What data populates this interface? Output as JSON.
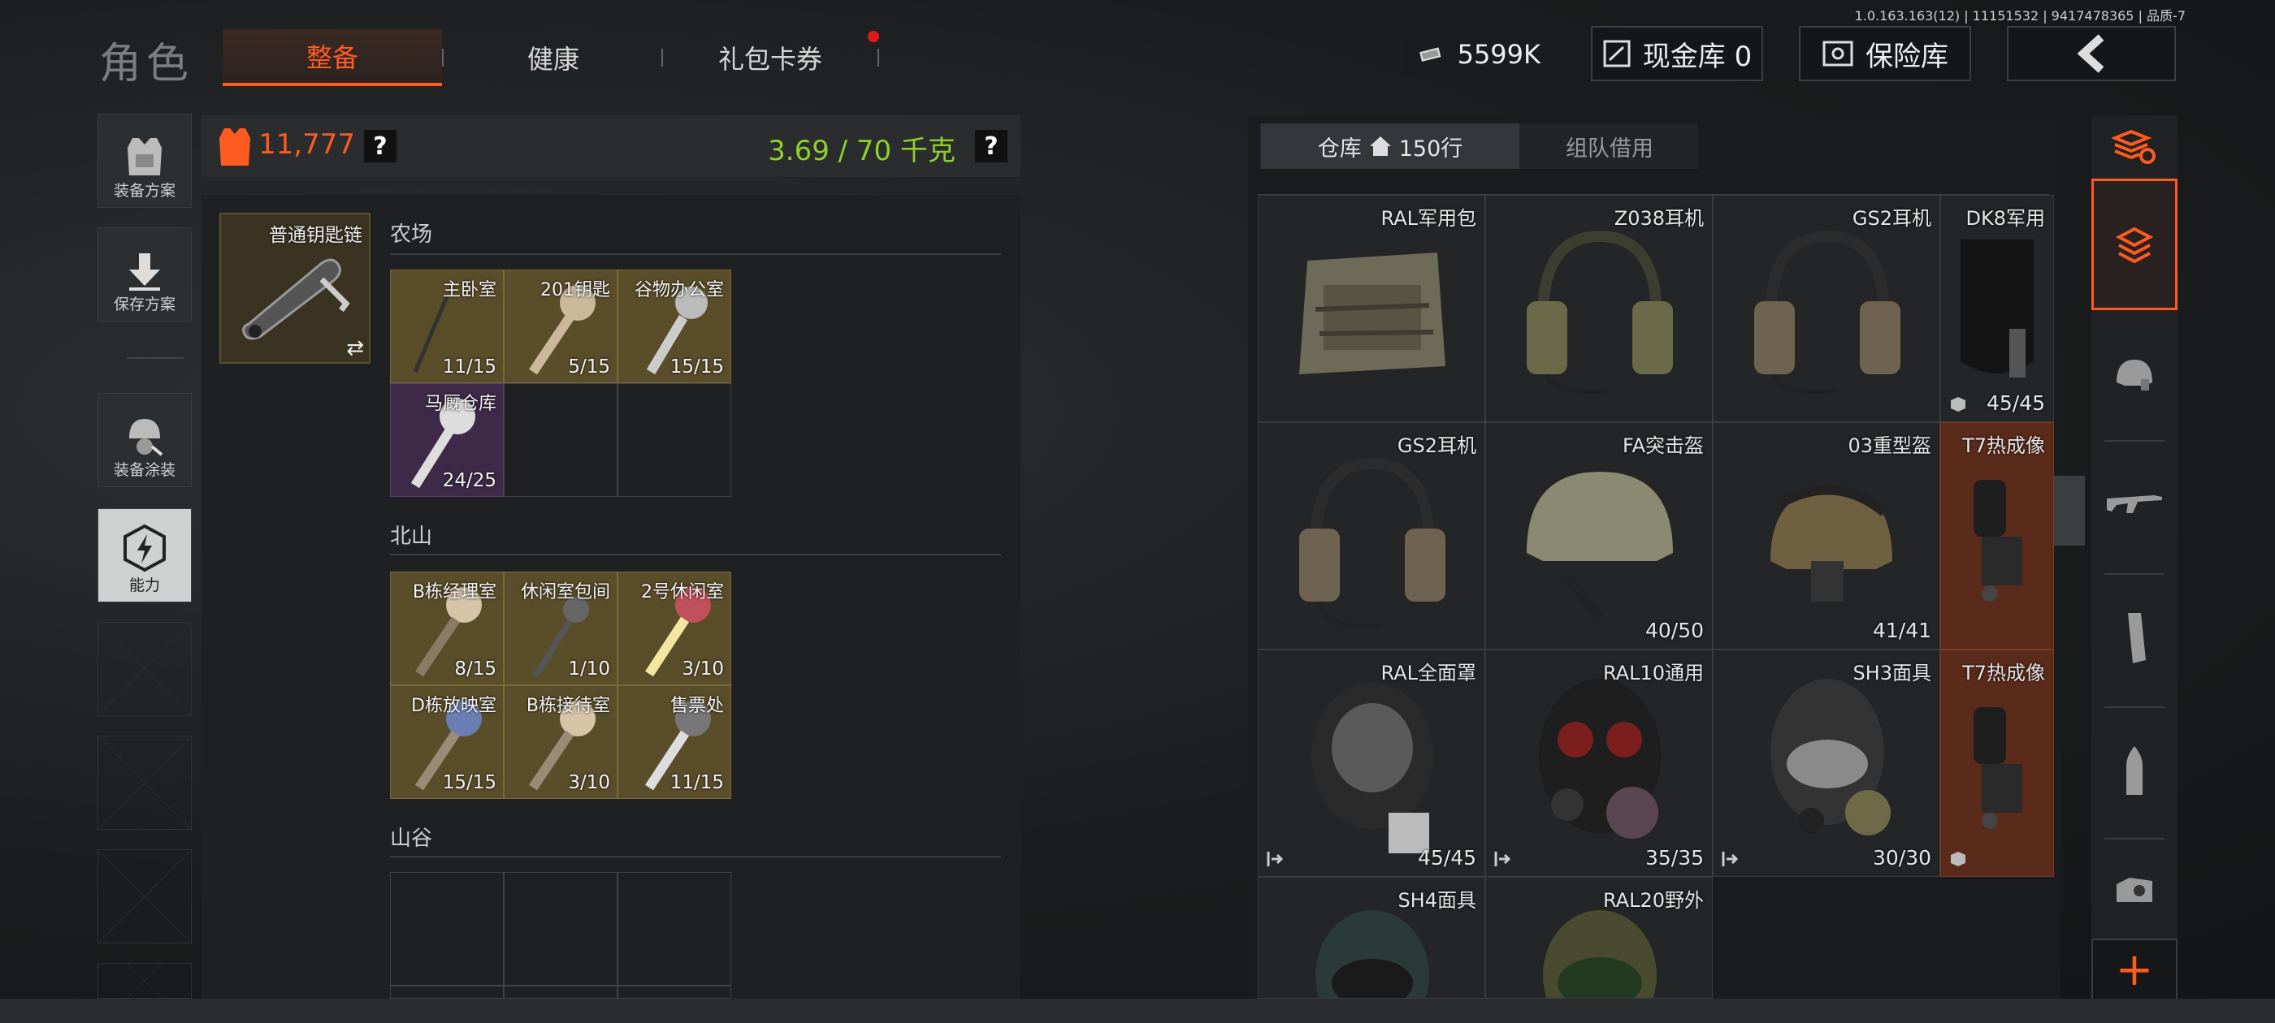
{
  "build_info": "1.0.163.163(12) | 11151532 | 9417478365 | 品质-7",
  "header": {
    "title": "角色",
    "tabs": [
      {
        "label": "整备",
        "active": true
      },
      {
        "label": "健康",
        "active": false
      },
      {
        "label": "礼包卡券",
        "active": false,
        "notification": true
      }
    ],
    "money": "5599K",
    "cash_vault": "现金库 0",
    "safe_box": "保险库",
    "back_icon": "chevron-left-icon"
  },
  "sidebar": {
    "items": [
      {
        "label": "装备方案",
        "icon": "vest-icon"
      },
      {
        "label": "保存方案",
        "icon": "download-icon"
      },
      {
        "label": "装备涂装",
        "icon": "helmet-paint-icon"
      },
      {
        "label": "能力",
        "icon": "lightning-hex-icon"
      }
    ]
  },
  "loadout": {
    "armor_value": "11,777",
    "weight": "3.69 / 70 千克",
    "help": "?",
    "keychain": {
      "name": "普通钥匙链",
      "swap_icon": "swap-icon"
    },
    "sections": [
      {
        "title": "农场",
        "keys": [
          {
            "name": "主卧室",
            "count": "11/15"
          },
          {
            "name": "201钥匙",
            "count": "5/15"
          },
          {
            "name": "谷物办公室",
            "count": "15/15"
          },
          {
            "name": "马厩仓库",
            "count": "24/25",
            "rarity": "purple"
          }
        ]
      },
      {
        "title": "北山",
        "keys": [
          {
            "name": "B栋经理室",
            "count": "8/15"
          },
          {
            "name": "休闲室包间",
            "count": "1/10"
          },
          {
            "name": "2号休闲室",
            "count": "3/10"
          },
          {
            "name": "D栋放映室",
            "count": "15/15"
          },
          {
            "name": "B栋接待室",
            "count": "3/10"
          },
          {
            "name": "售票处",
            "count": "11/15"
          }
        ]
      },
      {
        "title": "山谷",
        "keys": []
      }
    ]
  },
  "storage": {
    "tabs": [
      {
        "label": "仓库",
        "sub": "150行",
        "active": true
      },
      {
        "label": "组队借用",
        "active": false
      }
    ],
    "items": [
      {
        "name": "RAL军用包",
        "count": "",
        "icon": ""
      },
      {
        "name": "Z038耳机",
        "count": "",
        "icon": ""
      },
      {
        "name": "GS2耳机",
        "count": "",
        "icon": ""
      },
      {
        "name": "DK8军用",
        "count": "45/45",
        "icon": "box-icon"
      },
      {
        "name": "GS2耳机",
        "count": "",
        "icon": ""
      },
      {
        "name": "FA突击盔",
        "count": "40/50",
        "icon": ""
      },
      {
        "name": "03重型盔",
        "count": "41/41",
        "icon": ""
      },
      {
        "name": "T7热成像",
        "count": "",
        "icon": ""
      },
      {
        "name": "RAL全面罩",
        "count": "45/45",
        "icon": "exit-icon"
      },
      {
        "name": "RAL10通用",
        "count": "35/35",
        "icon": "exit-icon"
      },
      {
        "name": "SH3面具",
        "count": "30/30",
        "icon": "exit-icon"
      },
      {
        "name": "T7热成像",
        "count": "",
        "icon": "box-icon"
      },
      {
        "name": "SH4面具",
        "count": "",
        "icon": ""
      },
      {
        "name": "RAL20野外",
        "count": "",
        "icon": ""
      }
    ]
  },
  "rail": {
    "plus": "+"
  }
}
